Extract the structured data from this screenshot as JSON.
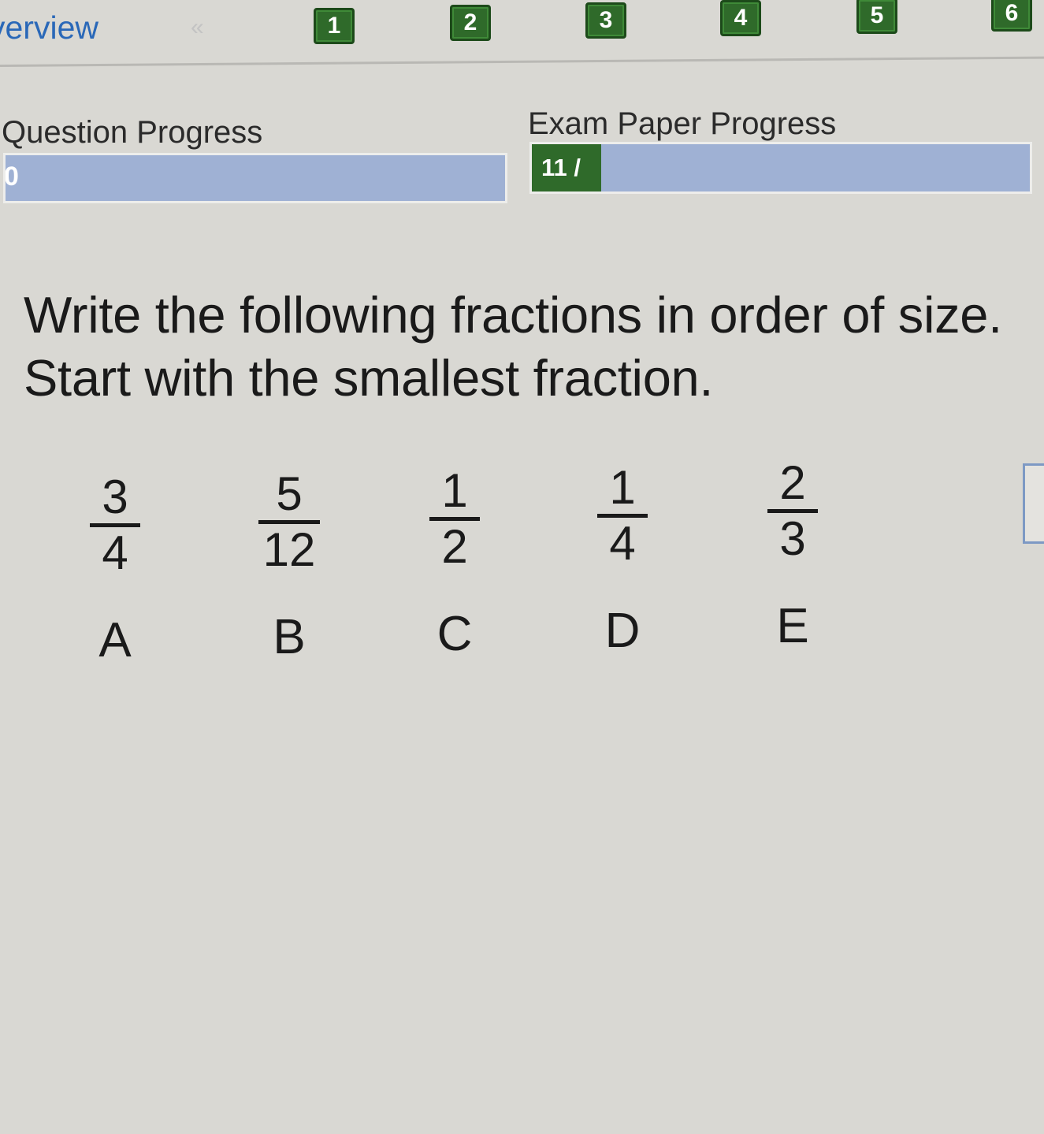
{
  "nav": {
    "overview_label": "verview",
    "prev_glyph": "«",
    "questions": [
      "1",
      "2",
      "3",
      "4",
      "5",
      "6"
    ]
  },
  "question_progress": {
    "label": "Question Progress",
    "text": "0"
  },
  "exam_progress": {
    "label": "Exam Paper Progress",
    "text": "11 /"
  },
  "question": {
    "line1": "Write the following fractions in order of size.",
    "line2": "Start with the smallest fraction."
  },
  "fractions": [
    {
      "numerator": "3",
      "denominator": "4",
      "letter": "A"
    },
    {
      "numerator": "5",
      "denominator": "12",
      "letter": "B"
    },
    {
      "numerator": "1",
      "denominator": "2",
      "letter": "C"
    },
    {
      "numerator": "1",
      "denominator": "4",
      "letter": "D"
    },
    {
      "numerator": "2",
      "denominator": "3",
      "letter": "E"
    }
  ],
  "colors": {
    "background": "#d9d8d3",
    "link_blue": "#2a68b8",
    "nav_green": "#2f6a2a",
    "progress_blue": "#9fb1d4"
  }
}
